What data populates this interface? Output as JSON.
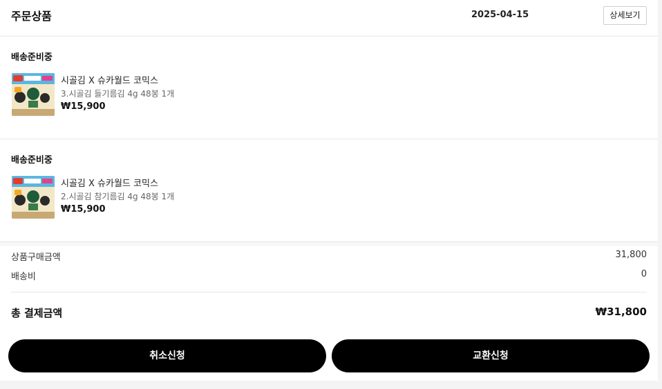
{
  "header": {
    "title": "주문상품",
    "date": "2025-04-15",
    "detail_label": "상세보기"
  },
  "items": [
    {
      "status": "배송준비중",
      "name": "시골김 X 슈카월드 코믹스",
      "option": "3.시골김 들기름김 4g 48봉 1개",
      "price": "₩15,900",
      "thumb_icon": "seaweed-product-thumbnail"
    },
    {
      "status": "배송준비중",
      "name": "시골김 X 슈카월드 코믹스",
      "option": "2.시골김 참기름김 4g 48봉 1개",
      "price": "₩15,900",
      "thumb_icon": "seaweed-product-thumbnail"
    }
  ],
  "summary": {
    "subtotal_label": "상품구매금액",
    "subtotal_value": "31,800",
    "shipping_label": "배송비",
    "shipping_value": "0",
    "total_label": "총 결제금액",
    "total_value": "₩31,800"
  },
  "actions": {
    "cancel_label": "취소신청",
    "exchange_label": "교환신청"
  },
  "colors": {
    "button_bg": "#000000",
    "button_text": "#ffffff",
    "divider": "#e6e6e6"
  }
}
